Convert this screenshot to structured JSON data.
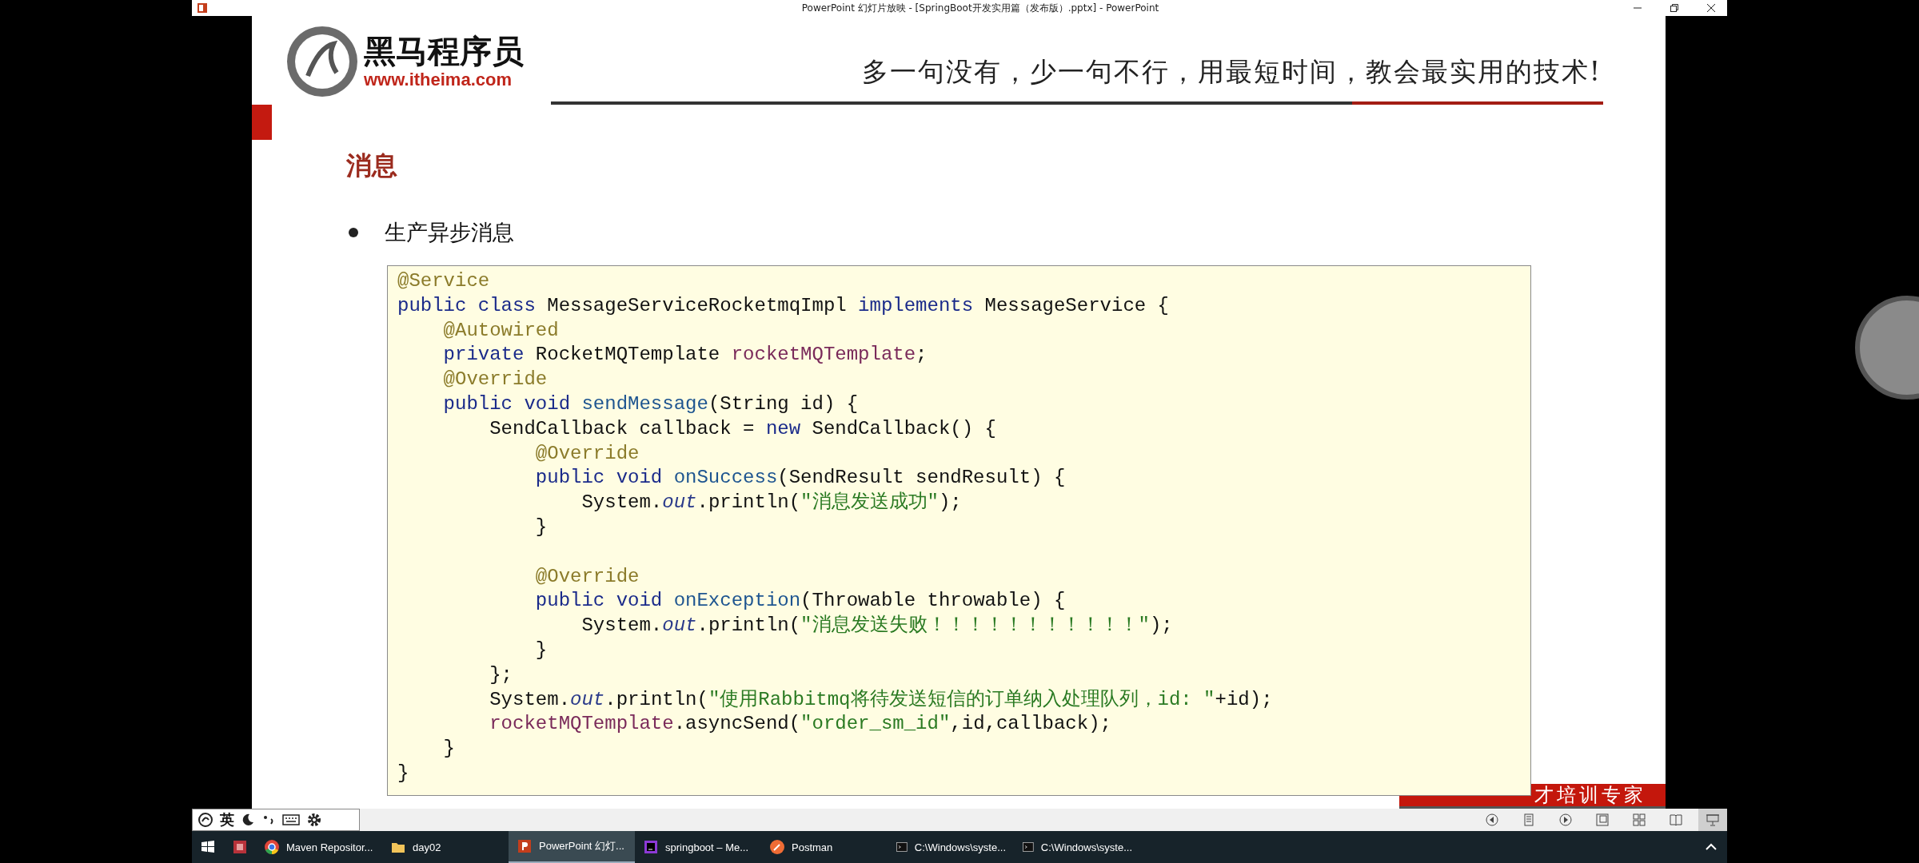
{
  "window": {
    "title": "PowerPoint 幻灯片放映 - [SpringBoot开发实用篇（发布版）.pptx] - PowerPoint"
  },
  "slide": {
    "logo": {
      "name": "黑马程序员",
      "url": "www.itheima.com"
    },
    "slogan": "多一句没有，少一句不行，用最短时间，教会最实用的技术!",
    "heading": "消息",
    "bullets": [
      "生产异步消息"
    ],
    "code": [
      {
        "tokens": [
          {
            "text": "@Service",
            "kind": "ann"
          }
        ]
      },
      {
        "tokens": [
          {
            "text": "public class ",
            "kind": "kw"
          },
          {
            "text": "MessageServiceRocketmqImpl ",
            "kind": "plain"
          },
          {
            "text": "implements ",
            "kind": "kw"
          },
          {
            "text": "MessageService {",
            "kind": "plain"
          }
        ]
      },
      {
        "tokens": [
          {
            "text": "    @Autowired",
            "kind": "ann"
          }
        ]
      },
      {
        "tokens": [
          {
            "text": "    private ",
            "kind": "kw"
          },
          {
            "text": "RocketMQTemplate ",
            "kind": "plain"
          },
          {
            "text": "rocketMQTemplate",
            "kind": "field"
          },
          {
            "text": ";",
            "kind": "plain"
          }
        ]
      },
      {
        "tokens": [
          {
            "text": "    @Override",
            "kind": "ann"
          }
        ]
      },
      {
        "tokens": [
          {
            "text": "    public void ",
            "kind": "kw"
          },
          {
            "text": "sendMessage",
            "kind": "method"
          },
          {
            "text": "(String id) {",
            "kind": "plain"
          }
        ]
      },
      {
        "tokens": [
          {
            "text": "        SendCallback callback = ",
            "kind": "plain"
          },
          {
            "text": "new ",
            "kind": "kw"
          },
          {
            "text": "SendCallback() {",
            "kind": "plain"
          }
        ]
      },
      {
        "tokens": [
          {
            "text": "            @Override",
            "kind": "ann"
          }
        ]
      },
      {
        "tokens": [
          {
            "text": "            public void ",
            "kind": "kw"
          },
          {
            "text": "onSuccess",
            "kind": "method"
          },
          {
            "text": "(SendResult sendResult) {",
            "kind": "plain"
          }
        ]
      },
      {
        "tokens": [
          {
            "text": "                System.",
            "kind": "plain"
          },
          {
            "text": "out",
            "kind": "italic"
          },
          {
            "text": ".println(",
            "kind": "plain"
          },
          {
            "text": "\"消息发送成功\"",
            "kind": "str"
          },
          {
            "text": ");",
            "kind": "plain"
          }
        ]
      },
      {
        "tokens": [
          {
            "text": "            }",
            "kind": "plain"
          }
        ]
      },
      {
        "spaced": true,
        "tokens": [
          {
            "text": "            @Override",
            "kind": "ann"
          }
        ]
      },
      {
        "tokens": [
          {
            "text": "            public void ",
            "kind": "kw"
          },
          {
            "text": "onException",
            "kind": "method"
          },
          {
            "text": "(Throwable throwable) {",
            "kind": "plain"
          }
        ]
      },
      {
        "tokens": [
          {
            "text": "                System.",
            "kind": "plain"
          },
          {
            "text": "out",
            "kind": "italic"
          },
          {
            "text": ".println(",
            "kind": "plain"
          },
          {
            "text": "\"消息发送失败！！！！！！！！！！！\"",
            "kind": "str"
          },
          {
            "text": ");",
            "kind": "plain"
          }
        ]
      },
      {
        "tokens": [
          {
            "text": "            }",
            "kind": "plain"
          }
        ]
      },
      {
        "tokens": [
          {
            "text": "        };",
            "kind": "plain"
          }
        ]
      },
      {
        "tokens": [
          {
            "text": "        System.",
            "kind": "plain"
          },
          {
            "text": "out",
            "kind": "italic"
          },
          {
            "text": ".println(",
            "kind": "plain"
          },
          {
            "text": "\"使用Rabbitmq将待发送短信的订单纳入处理队列，id: \"",
            "kind": "str"
          },
          {
            "text": "+id);",
            "kind": "plain"
          }
        ]
      },
      {
        "tokens": [
          {
            "text": "        rocketMQTemplate",
            "kind": "field"
          },
          {
            "text": ".asyncSend(",
            "kind": "plain"
          },
          {
            "text": "\"order_sm_id\"",
            "kind": "str"
          },
          {
            "text": ",id,callback);",
            "kind": "plain"
          }
        ]
      },
      {
        "tokens": [
          {
            "text": "    }",
            "kind": "plain"
          }
        ]
      },
      {
        "tokens": [
          {
            "text": "}",
            "kind": "plain"
          }
        ]
      }
    ],
    "banner": "才培训专家"
  },
  "language_bar": {
    "mode": "英"
  },
  "status_bar": {
    "views": [
      {
        "kind": "prev",
        "selected": false
      },
      {
        "kind": "menu",
        "selected": false
      },
      {
        "kind": "next",
        "selected": false
      },
      {
        "kind": "normal",
        "selected": false
      },
      {
        "kind": "sorter",
        "selected": false
      },
      {
        "kind": "reading",
        "selected": false
      },
      {
        "kind": "slideshow",
        "selected": true
      }
    ]
  },
  "taskbar": {
    "items": [
      {
        "kind": "start",
        "selected": false
      },
      {
        "kind": "app",
        "selected": false
      },
      {
        "kind": "chrome",
        "label": "Maven Repositor...",
        "selected": false
      },
      {
        "kind": "folder",
        "label": "day02",
        "selected": false
      },
      {
        "kind": "powerpoint",
        "label": "PowerPoint 幻灯...",
        "selected": true
      },
      {
        "kind": "ide",
        "label": "springboot – Me...",
        "selected": false
      },
      {
        "kind": "postman",
        "label": "Postman",
        "selected": false
      },
      {
        "kind": "console",
        "label": "C:\\Windows\\syste...",
        "selected": false
      },
      {
        "kind": "console",
        "label": "C:\\Windows\\syste...",
        "selected": false
      }
    ]
  }
}
